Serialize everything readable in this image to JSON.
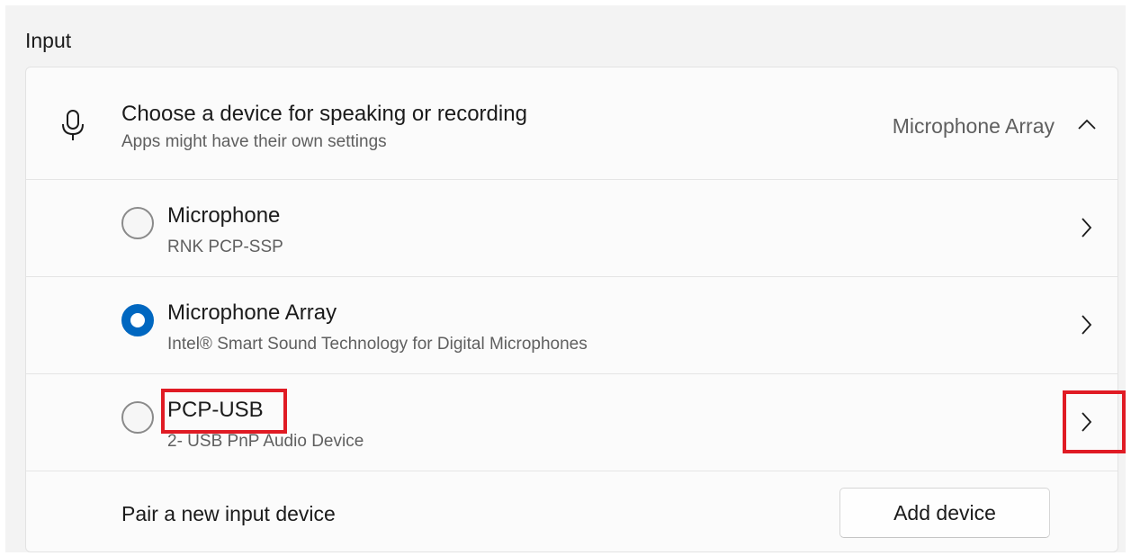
{
  "section": {
    "title": "Input"
  },
  "header": {
    "title": "Choose a device for speaking or recording",
    "subtitle": "Apps might have their own settings",
    "selected_value": "Microphone Array",
    "icon": "microphone-icon",
    "expand_icon": "chevron-up-icon"
  },
  "devices": [
    {
      "name": "Microphone",
      "description": "RNK PCP-SSP",
      "selected": false
    },
    {
      "name": "Microphone Array",
      "description": "Intel® Smart Sound Technology for Digital Microphones",
      "selected": true
    },
    {
      "name": "PCP-USB",
      "description": "2- USB PnP Audio Device",
      "selected": false
    }
  ],
  "pair": {
    "label": "Pair a new input device",
    "button_label": "Add device"
  },
  "colors": {
    "accent": "#0067c0",
    "highlight": "#e01b24",
    "panel_bg": "#f3f3f3",
    "card_bg": "#fbfbfb"
  }
}
